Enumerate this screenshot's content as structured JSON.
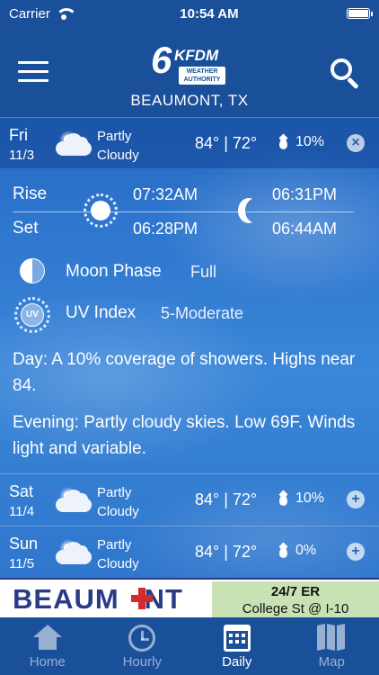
{
  "status_bar": {
    "carrier": "Carrier",
    "time": "10:54 AM"
  },
  "header": {
    "logo_number": "6",
    "logo_callsign": "KFDM",
    "logo_tagline_1": "WEATHER",
    "logo_tagline_2": "AUTHORITY",
    "location": "BEAUMONT, TX"
  },
  "forecast_days": [
    {
      "day": "Fri",
      "date": "11/3",
      "condition_line1": "Partly",
      "condition_line2": "Cloudy",
      "icon": "partly-cloudy-icon",
      "temps": "84° | 72°",
      "precip": "10%",
      "toggle": "×",
      "expanded": true
    },
    {
      "day": "Sat",
      "date": "11/4",
      "condition_line1": "Partly",
      "condition_line2": "Cloudy",
      "icon": "partly-cloudy-icon",
      "temps": "84° | 72°",
      "precip": "10%",
      "toggle": "+",
      "expanded": false
    },
    {
      "day": "Sun",
      "date": "11/5",
      "condition_line1": "Partly",
      "condition_line2": "Cloudy",
      "icon": "partly-cloudy-icon",
      "temps": "84° | 72°",
      "precip": "0%",
      "toggle": "+",
      "expanded": false
    }
  ],
  "details": {
    "rise_label": "Rise",
    "set_label": "Set",
    "sunrise": "07:32AM",
    "sunset": "06:28PM",
    "moonrise": "06:31PM",
    "moonset": "06:44AM",
    "moon_phase_label": "Moon Phase",
    "moon_phase_value": "Full",
    "uv_label": "UV Index",
    "uv_value": "5-Moderate",
    "uv_badge": "UV",
    "day_text": "Day: A 10% coverage of showers.  Highs near 84.",
    "evening_text": "Evening: Partly cloudy skies. Low 69F. Winds light and variable."
  },
  "ad": {
    "brand_part1": "BEAUM",
    "brand_part2": "NT",
    "line1": "24/7 ER",
    "line2": "College St @ I-10"
  },
  "tabs": [
    {
      "label": "Home",
      "icon": "home-icon",
      "active": false
    },
    {
      "label": "Hourly",
      "icon": "clock-icon",
      "active": false
    },
    {
      "label": "Daily",
      "icon": "calendar-icon",
      "active": true
    },
    {
      "label": "Map",
      "icon": "map-icon",
      "active": false
    }
  ],
  "colors": {
    "header_blue": "#1a4f9a",
    "ad_navy": "#2b3a86",
    "ad_red": "#d32a2a",
    "ad_green": "#c9e2b5"
  }
}
